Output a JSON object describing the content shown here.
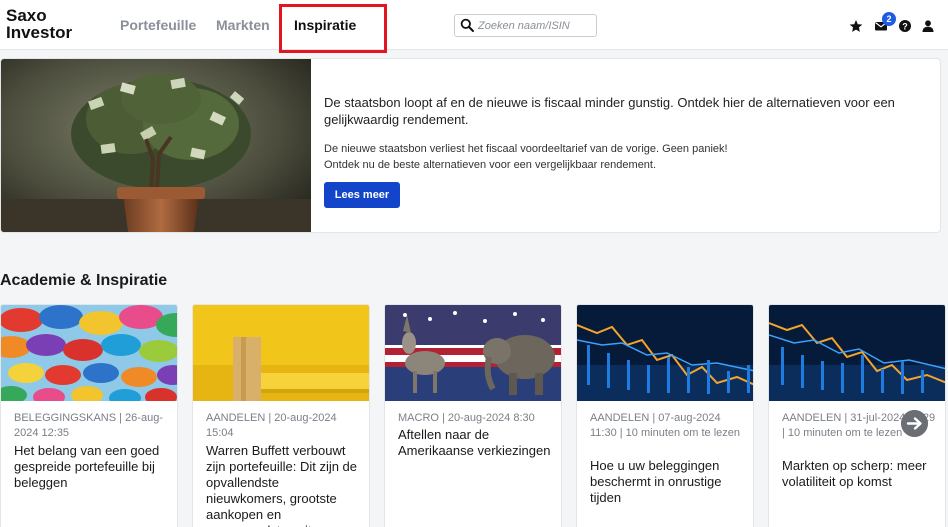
{
  "header": {
    "logo_line1": "Saxo",
    "logo_line2": "Investor",
    "nav": [
      {
        "label": "Portefeuille"
      },
      {
        "label": "Markten"
      },
      {
        "label": "Inspiratie"
      }
    ],
    "search": {
      "placeholder": "Zoeken naam/ISIN",
      "icon": "search-icon"
    },
    "notifications_badge": "2",
    "icons": [
      "star-icon",
      "mail-icon",
      "help-icon",
      "user-icon"
    ]
  },
  "hero": {
    "title": "De staatsbon loopt af en de nieuwe is fiscaal minder gunstig. Ontdek hier de alternatieven voor een gelijkwaardig rendement.",
    "body_line1": "De nieuwe staatsbon verliest het fiscaal voordeeltarief van de vorige. Geen paniek!",
    "body_line2": "Ontdek nu de beste alternatieven voor een vergelijkbaar rendement.",
    "button_label": "Lees meer"
  },
  "section": {
    "title": "Academie & Inspiratie"
  },
  "cards": [
    {
      "meta": "BELEGGINGSKANS | 26-aug-2024 12:35",
      "title": "Het belang van een goed gespreide portefeuille bij beleggen"
    },
    {
      "meta": "AANDELEN | 20-aug-2024 15:04",
      "title": "Warren Buffett verbouwt zijn portefeuille: Dit zijn de opvallendste nieuwkomers, grootste aankopen en verrassendste exits"
    },
    {
      "meta": "MACRO | 20-aug-2024 8:30",
      "title": "Aftellen naar de Amerikaanse verkiezingen"
    },
    {
      "meta": "AANDELEN | 07-aug-2024 11:30 | 10 minuten om te lezen",
      "title": "Hoe u uw beleggingen beschermt in onrustige tijden"
    },
    {
      "meta": "AANDELEN | 31-jul-2024 11:29 | 10 minuten om te lezen",
      "title": "Markten op scherp: meer volatiliteit op komst"
    }
  ],
  "colors": {
    "accent": "#1245c9",
    "highlight": "#e3161f",
    "badge": "#1f5ce3"
  }
}
